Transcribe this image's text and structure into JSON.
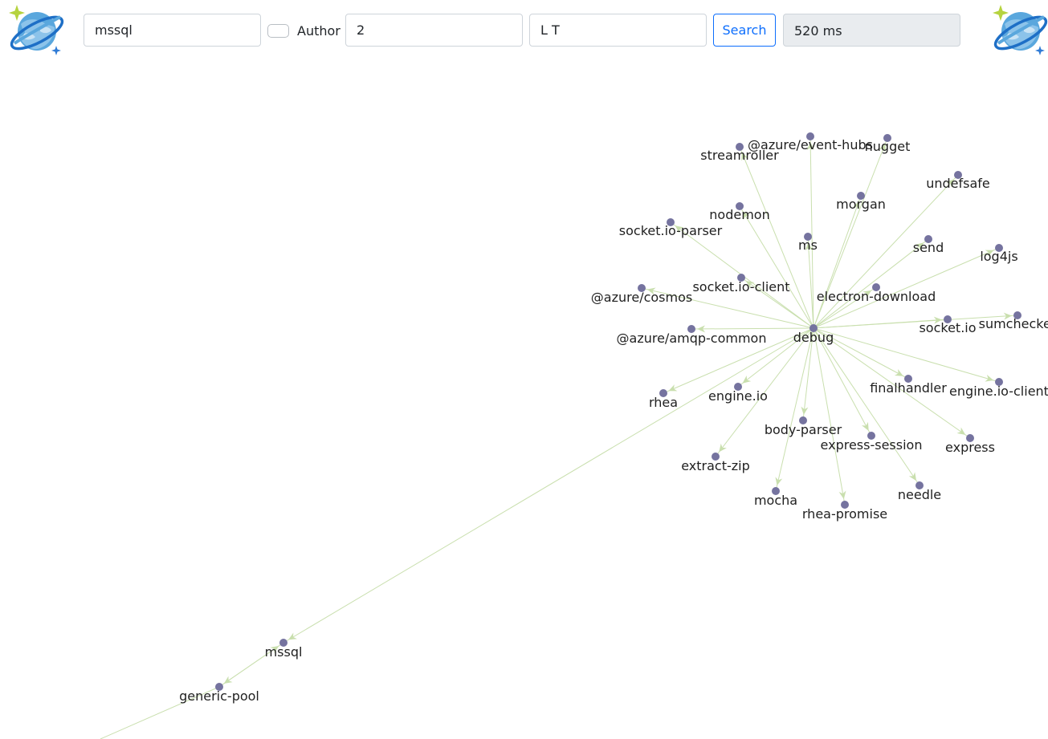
{
  "toolbar": {
    "package_input": "mssql",
    "author_label": "Author",
    "depth_input": "2",
    "direction_input": "L T",
    "search_label": "Search",
    "timing": "520 ms"
  },
  "colors": {
    "edge": "#c9dfae",
    "arrow": "#c9dfae",
    "node": "#75739f",
    "button_accent": "#0d6efd"
  },
  "graph": {
    "nodes": [
      {
        "id": "debug",
        "label": "debug"
      },
      {
        "id": "mssql",
        "label": "mssql"
      },
      {
        "id": "generic-pool",
        "label": "generic-pool"
      },
      {
        "id": "streamroller",
        "label": "streamroller"
      },
      {
        "id": "event-hubs",
        "label": "@azure/event-hubs"
      },
      {
        "id": "nugget",
        "label": "nugget"
      },
      {
        "id": "undefsafe",
        "label": "undefsafe"
      },
      {
        "id": "nodemon",
        "label": "nodemon"
      },
      {
        "id": "morgan",
        "label": "morgan"
      },
      {
        "id": "socket-io-parser",
        "label": "socket.io-parser"
      },
      {
        "id": "ms",
        "label": "ms"
      },
      {
        "id": "send",
        "label": "send"
      },
      {
        "id": "log4js",
        "label": "log4js"
      },
      {
        "id": "socket-io-client",
        "label": "socket.io-client"
      },
      {
        "id": "cosmos",
        "label": "@azure/cosmos"
      },
      {
        "id": "electron-download",
        "label": "electron-download"
      },
      {
        "id": "amqp-common",
        "label": "@azure/amqp-common"
      },
      {
        "id": "socket-io",
        "label": "socket.io"
      },
      {
        "id": "sumchecker",
        "label": "sumchecker"
      },
      {
        "id": "rhea",
        "label": "rhea"
      },
      {
        "id": "engine-io",
        "label": "engine.io"
      },
      {
        "id": "finalhandler",
        "label": "finalhandler"
      },
      {
        "id": "engine-io-client",
        "label": "engine.io-client"
      },
      {
        "id": "body-parser",
        "label": "body-parser"
      },
      {
        "id": "express-session",
        "label": "express-session"
      },
      {
        "id": "express",
        "label": "express"
      },
      {
        "id": "extract-zip",
        "label": "extract-zip"
      },
      {
        "id": "mocha",
        "label": "mocha"
      },
      {
        "id": "needle",
        "label": "needle"
      },
      {
        "id": "rhea-promise",
        "label": "rhea-promise"
      }
    ],
    "edges": [
      {
        "source": "generic-pool",
        "target": "mssql"
      },
      {
        "source": "mssql",
        "target": "generic-pool"
      },
      {
        "source": "debug",
        "target": "mssql"
      },
      {
        "source": "debug",
        "target": "streamroller"
      },
      {
        "source": "debug",
        "target": "event-hubs"
      },
      {
        "source": "debug",
        "target": "nugget"
      },
      {
        "source": "debug",
        "target": "undefsafe"
      },
      {
        "source": "debug",
        "target": "nodemon"
      },
      {
        "source": "debug",
        "target": "morgan"
      },
      {
        "source": "debug",
        "target": "socket-io-parser"
      },
      {
        "source": "debug",
        "target": "ms"
      },
      {
        "source": "debug",
        "target": "send"
      },
      {
        "source": "debug",
        "target": "log4js"
      },
      {
        "source": "debug",
        "target": "socket-io-client"
      },
      {
        "source": "debug",
        "target": "cosmos"
      },
      {
        "source": "debug",
        "target": "electron-download"
      },
      {
        "source": "debug",
        "target": "amqp-common"
      },
      {
        "source": "debug",
        "target": "socket-io"
      },
      {
        "source": "debug",
        "target": "sumchecker"
      },
      {
        "source": "debug",
        "target": "rhea"
      },
      {
        "source": "debug",
        "target": "engine-io"
      },
      {
        "source": "debug",
        "target": "finalhandler"
      },
      {
        "source": "debug",
        "target": "engine-io-client"
      },
      {
        "source": "debug",
        "target": "body-parser"
      },
      {
        "source": "debug",
        "target": "express-session"
      },
      {
        "source": "debug",
        "target": "express"
      },
      {
        "source": "debug",
        "target": "extract-zip"
      },
      {
        "source": "debug",
        "target": "mocha"
      },
      {
        "source": "debug",
        "target": "needle"
      },
      {
        "source": "debug",
        "target": "rhea-promise"
      }
    ]
  }
}
